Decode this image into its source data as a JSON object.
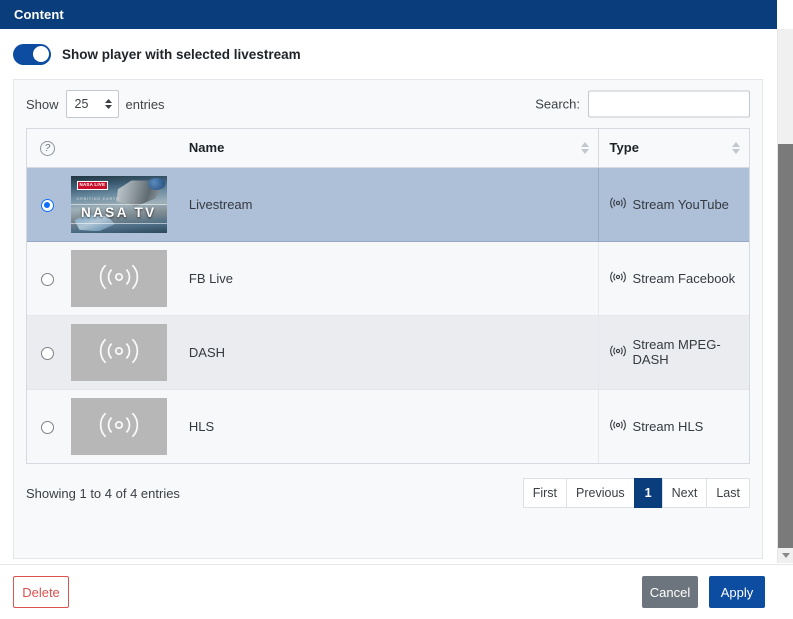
{
  "window": {
    "title": "Content"
  },
  "toggle": {
    "label": "Show player with selected livestream",
    "state": "on",
    "accent_color": "#0c4da2"
  },
  "table_controls": {
    "show_label": "Show",
    "entries_label": "entries",
    "page_size": "25",
    "search_label": "Search:",
    "search_value": "",
    "search_placeholder": ""
  },
  "table": {
    "columns": [
      {
        "key": "select",
        "label": "",
        "icon": "help-circle-icon",
        "sortable": false
      },
      {
        "key": "thumb",
        "label": "",
        "sortable": false
      },
      {
        "key": "name",
        "label": "Name",
        "sortable": true
      },
      {
        "key": "type",
        "label": "Type",
        "sortable": true
      }
    ],
    "rows": [
      {
        "selected": true,
        "thumbnail": "nasa-tv-thumbnail",
        "thumbnail_badge": "NASA LIVE",
        "thumbnail_subtitle": "ORBITING EARTH",
        "thumbnail_text": "NASA TV",
        "name": "Livestream",
        "type": "Stream YouTube",
        "type_icon": "broadcast-icon"
      },
      {
        "selected": false,
        "thumbnail": "placeholder-broadcast-thumbnail",
        "name": "FB Live",
        "type": "Stream Facebook",
        "type_icon": "broadcast-icon"
      },
      {
        "selected": false,
        "thumbnail": "placeholder-broadcast-thumbnail",
        "name": "DASH",
        "type": "Stream MPEG-DASH",
        "type_icon": "broadcast-icon"
      },
      {
        "selected": false,
        "thumbnail": "placeholder-broadcast-thumbnail",
        "name": "HLS",
        "type": "Stream HLS",
        "type_icon": "broadcast-icon"
      }
    ]
  },
  "footer": {
    "showing_text": "Showing 1 to 4 of 4 entries",
    "pagination": [
      {
        "label": "First",
        "active": false
      },
      {
        "label": "Previous",
        "active": false
      },
      {
        "label": "1",
        "active": true
      },
      {
        "label": "Next",
        "active": false
      },
      {
        "label": "Last",
        "active": false
      }
    ]
  },
  "actions": {
    "delete_label": "Delete",
    "cancel_label": "Cancel",
    "apply_label": "Apply",
    "delete_color": "#d9534f",
    "cancel_color": "#6c757d",
    "apply_color": "#0c4da2"
  },
  "colors": {
    "header_bg": "#0a3d7c",
    "selected_row": "#aebfd8"
  }
}
